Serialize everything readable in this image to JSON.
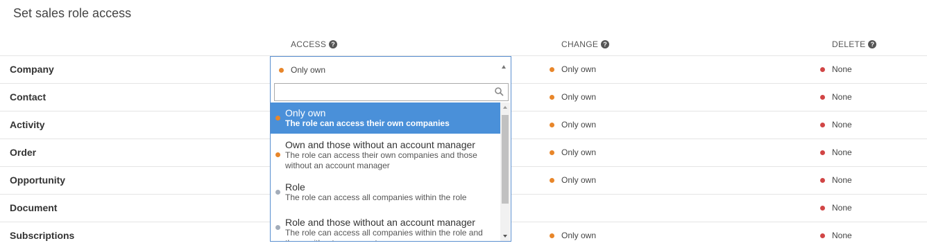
{
  "page": {
    "title": "Set sales role access"
  },
  "columns": {
    "access": "ACCESS",
    "change": "CHANGE",
    "delete": "DELETE",
    "help_glyph": "?"
  },
  "colors": {
    "orange": "#e8862a",
    "red": "#d14545",
    "gray": "#a3acb9",
    "selected": "#4a90d9"
  },
  "rows": [
    {
      "label": "Company",
      "change": "Only own",
      "delete": "None"
    },
    {
      "label": "Contact",
      "change": "Only own",
      "delete": "None"
    },
    {
      "label": "Activity",
      "change": "Only own",
      "delete": "None"
    },
    {
      "label": "Order",
      "change": "Only own",
      "delete": "None"
    },
    {
      "label": "Opportunity",
      "change": "Only own",
      "delete": "None"
    },
    {
      "label": "Document",
      "change": "",
      "delete": "None"
    },
    {
      "label": "Subscriptions",
      "change": "Only own",
      "delete": "None"
    }
  ],
  "select": {
    "value": "Only own",
    "search_value": "",
    "options": [
      {
        "title": "Only own",
        "desc": "The role can access their own companies",
        "color": "orange",
        "selected": true
      },
      {
        "title": "Own and those without an account manager",
        "desc": "The role can access their own companies and those without an account manager",
        "color": "orange",
        "selected": false
      },
      {
        "title": "Role",
        "desc": "The role can access all companies within the role",
        "color": "gray",
        "selected": false
      },
      {
        "title": "Role and those without an account manager",
        "desc": "The role can access all companies within the role and those without an account manager",
        "color": "gray",
        "selected": false
      }
    ]
  }
}
